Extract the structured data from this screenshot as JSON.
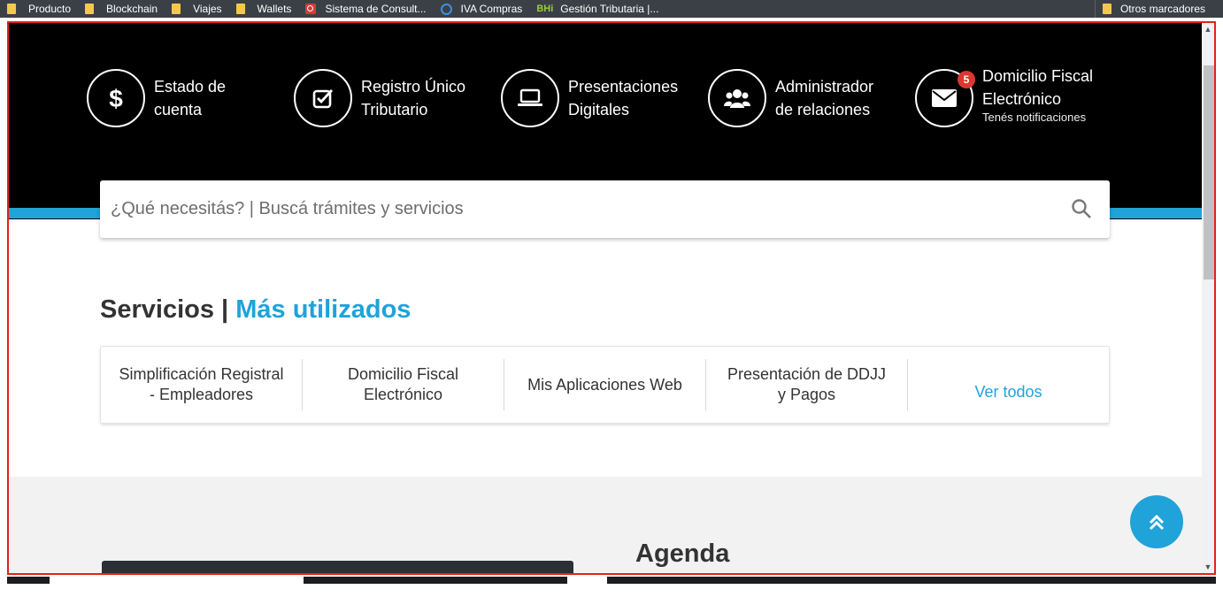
{
  "bookmarks": {
    "items": [
      {
        "label": "Producto",
        "icon": "folder-icon"
      },
      {
        "label": "Blockchain",
        "icon": "folder-icon"
      },
      {
        "label": "Viajes",
        "icon": "folder-icon"
      },
      {
        "label": "Wallets",
        "icon": "folder-icon"
      },
      {
        "label": "Sistema de Consult...",
        "icon": "search-site-icon"
      },
      {
        "label": "IVA Compras",
        "icon": "globe-icon"
      },
      {
        "label": "Gestión Tributaria |...",
        "icon": "bhi-icon"
      }
    ],
    "other": "Otros marcadores",
    "bhi_text": "BHi"
  },
  "quick_access": [
    {
      "line1": "Estado de",
      "line2": "cuenta",
      "icon": "dollar-icon"
    },
    {
      "line1": "Registro Único",
      "line2": "Tributario",
      "icon": "checkbox-icon"
    },
    {
      "line1": "Presentaciones",
      "line2": "Digitales",
      "icon": "laptop-icon"
    },
    {
      "line1": "Administrador",
      "line2": "de relaciones",
      "icon": "users-icon"
    },
    {
      "line1": "Domicilio Fiscal",
      "line2": "Electrónico",
      "sub": "Tenés notificaciones",
      "badge": "5",
      "icon": "envelope-icon"
    }
  ],
  "search": {
    "placeholder": "¿Qué necesitás? | Buscá trámites y servicios"
  },
  "services": {
    "title": "Servicios |",
    "title_accent": "Más utilizados",
    "items": [
      {
        "line1": "Simplificación Registral",
        "line2": "- Empleadores"
      },
      {
        "line1": "Domicilio Fiscal",
        "line2": "Electrónico"
      },
      {
        "line1": "Mis Aplicaciones Web",
        "line2": ""
      },
      {
        "line1": "Presentación de DDJJ",
        "line2": "y Pagos"
      },
      {
        "line1": "Ver todos",
        "line2": ""
      }
    ]
  },
  "agenda": {
    "title": "Agenda"
  },
  "colors": {
    "accent": "#1fa3d9",
    "badge": "#d9382f",
    "frame": "#e5201b"
  }
}
